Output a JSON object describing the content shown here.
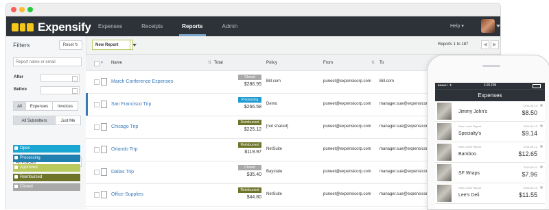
{
  "colors": {
    "topbar": "#2d3238",
    "link": "#3b7ab8",
    "closed": "#a9a9a9",
    "processing": "#1e9bd0",
    "reimbursed": "#6e7529",
    "approved": "#b9c95b",
    "open": "#1aa6d3"
  },
  "brand": {
    "name": "Expensify",
    "logo_icon": "expensify-logo-icon"
  },
  "nav": {
    "tabs": [
      "Expenses",
      "Receipts",
      "Reports",
      "Admin"
    ],
    "active": "Reports",
    "help": "Help ▾"
  },
  "sidebar": {
    "title": "Filters",
    "reset": "Reset",
    "search_placeholder": "Report name or email",
    "after_label": "After",
    "before_label": "Before",
    "type_filters": [
      "All",
      "Expenses",
      "Invoices"
    ],
    "submitter_filters": [
      "All Submitters",
      "Just Me"
    ],
    "policy_select": "All Policies",
    "statuses": [
      {
        "label": "Open",
        "color": "#1aa6d3"
      },
      {
        "label": "Processing",
        "color": "#1f7fae"
      },
      {
        "label": "Approved",
        "color": "#b9c95b"
      },
      {
        "label": "Reimbursed",
        "color": "#6e7529"
      },
      {
        "label": "Closed",
        "color": "#a9a9a9"
      }
    ]
  },
  "toolbar": {
    "new_report": "New Report",
    "count": "Reports 1 to 187"
  },
  "table": {
    "headers": {
      "name": "Name",
      "total": "Total",
      "policy": "Policy",
      "from": "From",
      "to": "To"
    },
    "rows": [
      {
        "name": "March Conference Expenses",
        "status": "Closed",
        "status_color": "#a9a9a9",
        "amount": "$286.95",
        "policy": "Bill.com",
        "from": "puneet@expensicorp.com",
        "to": "Bill.com"
      },
      {
        "name": "San Francisco Trip",
        "status": "Processing",
        "status_color": "#1e9bd0",
        "amount": "$266.58",
        "policy": "Demo",
        "from": "puneet@expensicorp.com",
        "to": "manager.sue@expensicorp"
      },
      {
        "name": "Chicago Trip",
        "status": "Reimbursed",
        "status_color": "#6e7529",
        "amount": "$225.12",
        "policy": "[not shared]",
        "from": "puneet@expensicorp.com",
        "to": "manager.sue@expensicorp"
      },
      {
        "name": "Orlando Trip",
        "status": "Reimbursed",
        "status_color": "#6e7529",
        "amount": "$119.97",
        "policy": "NetSuite",
        "from": "puneet@expensicorp.com",
        "to": "manager.sue@expensicorp"
      },
      {
        "name": "Dallas Trip",
        "status": "Closed",
        "status_color": "#a9a9a9",
        "amount": "$35.40",
        "policy": "Baystate",
        "from": "puneet@expensicorp.com",
        "to": "manager.sue@expensicorp"
      },
      {
        "name": "Office Supplies",
        "status": "Reimbursed",
        "status_color": "#6e7529",
        "amount": "$44.80",
        "policy": "NetSuite",
        "from": "puneet@expensicorp.com",
        "to": "manager.sue@expensicorp"
      }
    ]
  },
  "phone": {
    "carrier": "●●●●○ ✈",
    "time": "3:26 PM",
    "title": "Expenses",
    "expenses": [
      {
        "subtitle": "",
        "merchant": "Jimmy John's",
        "date": "2014-09-14",
        "amount": "$8.50"
      },
      {
        "subtitle": "New Lunch Report",
        "merchant": "Specialty's",
        "date": "2014-09-13",
        "amount": "$9.14"
      },
      {
        "subtitle": "New Lunch Report",
        "merchant": "Bamboo",
        "date": "2014-09-12",
        "amount": "$12.65"
      },
      {
        "subtitle": "",
        "merchant": "SF Wraps",
        "date": "2014-09-11",
        "amount": "$7.96"
      },
      {
        "subtitle": "New Lunch Report",
        "merchant": "Lee's Deli",
        "date": "2014-09-10",
        "amount": "$11.55"
      }
    ]
  }
}
